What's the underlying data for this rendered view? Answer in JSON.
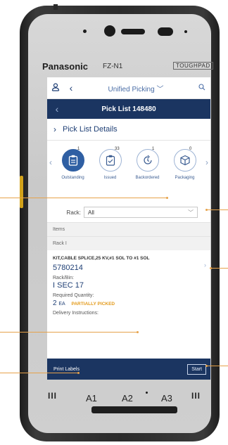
{
  "device": {
    "brand": "Panasonic",
    "model": "FZ-N1",
    "badge": "TOUGHPAD",
    "hw_keys": [
      "A1",
      "A2",
      "A3"
    ]
  },
  "topbar": {
    "title": "Unified Picking",
    "icons": [
      "person-icon",
      "back-icon",
      "chevron-down-icon",
      "search-icon"
    ]
  },
  "header": {
    "title": "Pick List 148480"
  },
  "details": {
    "label": "Pick List Details"
  },
  "tiles": [
    {
      "label": "Outstanding",
      "count": "1",
      "icon": "clipboard-icon"
    },
    {
      "label": "Issued",
      "count": "33",
      "icon": "clipboard-check-icon"
    },
    {
      "label": "Backordered",
      "count": "1",
      "icon": "clock-refresh-icon"
    },
    {
      "label": "Packaging",
      "count": "0",
      "icon": "box-icon"
    }
  ],
  "rack": {
    "label": "Rack:",
    "value": "All"
  },
  "sections": {
    "items": "Items",
    "rack": "Rack I"
  },
  "item": {
    "description": "KIT,CABLE SPLICE,25 KV,#1 SOL TO #1 SOL",
    "number": "5780214",
    "bin_label": "Rack/Bin:",
    "bin": "I SEC 17",
    "qty_label": "Required Quantity:",
    "qty": "2",
    "unit": "EA",
    "status": "PARTIALLY PICKED",
    "delivery_label": "Delivery Instructions:"
  },
  "footer": {
    "print": "Print Labels",
    "start": "Start"
  },
  "colors": {
    "navy": "#1b3561",
    "accent_blue": "#2f5fa3",
    "status_orange": "#e39a1a",
    "callout": "#e6a24a"
  }
}
